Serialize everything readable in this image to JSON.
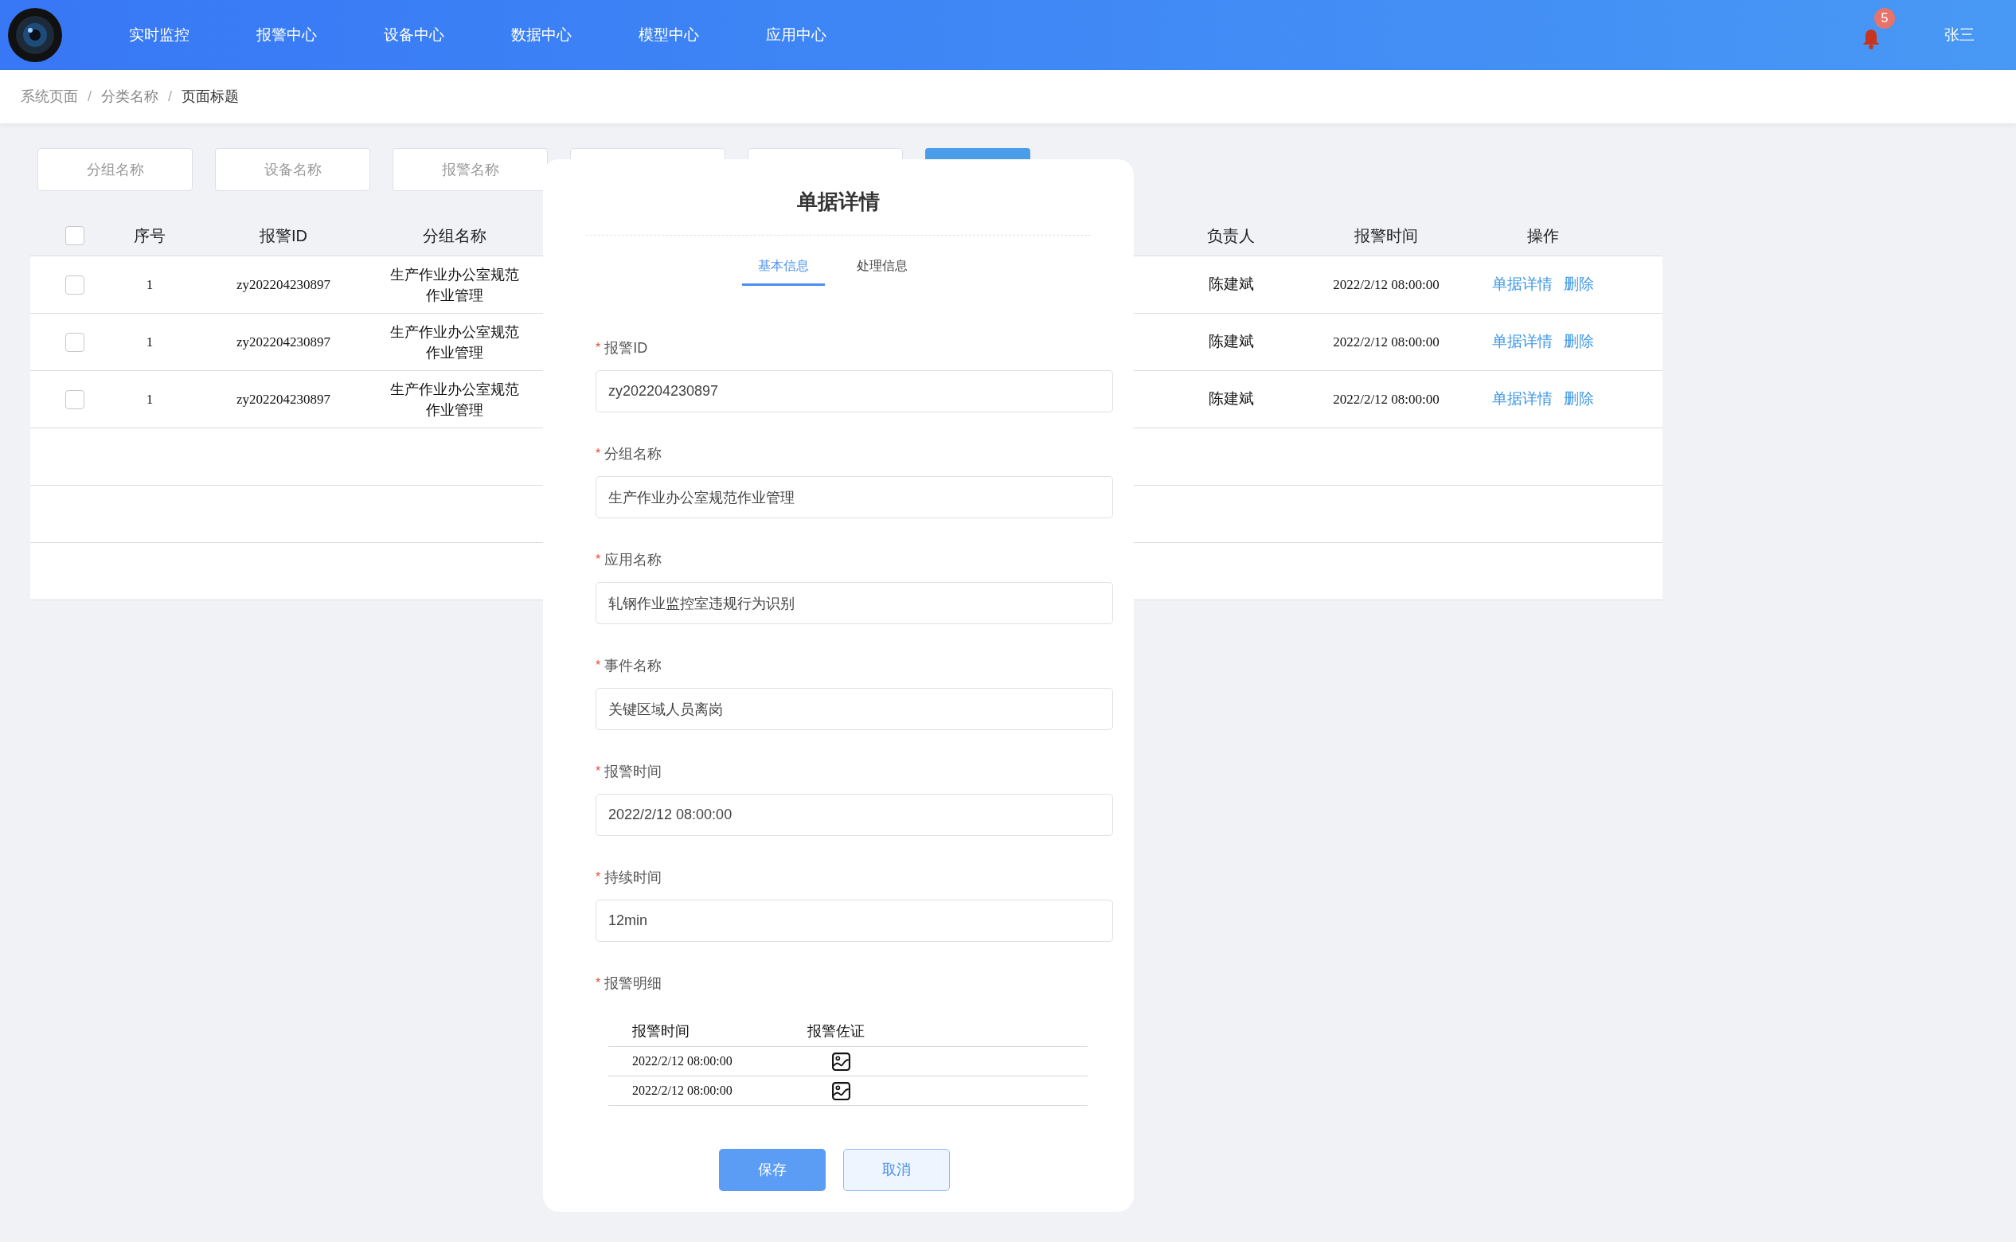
{
  "header": {
    "nav": [
      {
        "label": "实时监控"
      },
      {
        "label": "报警中心"
      },
      {
        "label": "设备中心"
      },
      {
        "label": "数据中心"
      },
      {
        "label": "模型中心"
      },
      {
        "label": "应用中心"
      }
    ],
    "notification_count": "5",
    "user": "张三"
  },
  "breadcrumb": {
    "separator": "/",
    "items": [
      "系统页面",
      "分类名称",
      "页面标题"
    ]
  },
  "filters": [
    {
      "placeholder": "分组名称"
    },
    {
      "placeholder": "设备名称"
    },
    {
      "placeholder": "报警名称"
    }
  ],
  "table": {
    "header_checked": false,
    "columns": [
      "序号",
      "报警ID",
      "分组名称",
      "负责人",
      "报警时间",
      "操作"
    ],
    "rows": [
      {
        "checked": false,
        "index": "1",
        "alarm_id": "zy202204230897",
        "group": "生产作业办公室规范作业管理",
        "owner": "陈建斌",
        "time": "2022/2/12 08:00:00",
        "actions": [
          "单据详情",
          "删除"
        ]
      },
      {
        "checked": false,
        "index": "1",
        "alarm_id": "zy202204230897",
        "group": "生产作业办公室规范作业管理",
        "owner": "陈建斌",
        "time": "2022/2/12 08:00:00",
        "actions": [
          "单据详情",
          "删除"
        ]
      },
      {
        "checked": false,
        "index": "1",
        "alarm_id": "zy202204230897",
        "group": "生产作业办公室规范作业管理",
        "owner": "陈建斌",
        "time": "2022/2/12 08:00:00",
        "actions": [
          "单据详情",
          "删除"
        ]
      }
    ]
  },
  "modal": {
    "title": "单据详情",
    "tabs": [
      {
        "label": "基本信息",
        "selected": true
      },
      {
        "label": "处理信息",
        "selected": false
      }
    ],
    "fields": [
      {
        "label": "报警ID",
        "required_mark": "*",
        "value": "zy202204230897"
      },
      {
        "label": "分组名称",
        "required_mark": "*",
        "value": "生产作业办公室规范作业管理"
      },
      {
        "label": "应用名称",
        "required_mark": "*",
        "value": "轧钢作业监控室违规行为识别"
      },
      {
        "label": "事件名称",
        "required_mark": "*",
        "value": "关键区域人员离岗"
      },
      {
        "label": "报警时间",
        "required_mark": "*",
        "value": "2022/2/12 08:00:00"
      },
      {
        "label": "持续时间",
        "required_mark": "*",
        "value": "12min"
      }
    ],
    "detail": {
      "label": "报警明细",
      "required_mark": "*",
      "columns": [
        "报警时间",
        "报警佐证"
      ],
      "rows": [
        {
          "time": "2022/2/12 08:00:00"
        },
        {
          "time": "2022/2/12 08:00:00"
        }
      ]
    },
    "buttons": [
      {
        "label": "保存",
        "kind": "primary"
      },
      {
        "label": "取消",
        "kind": "secondary"
      }
    ]
  }
}
